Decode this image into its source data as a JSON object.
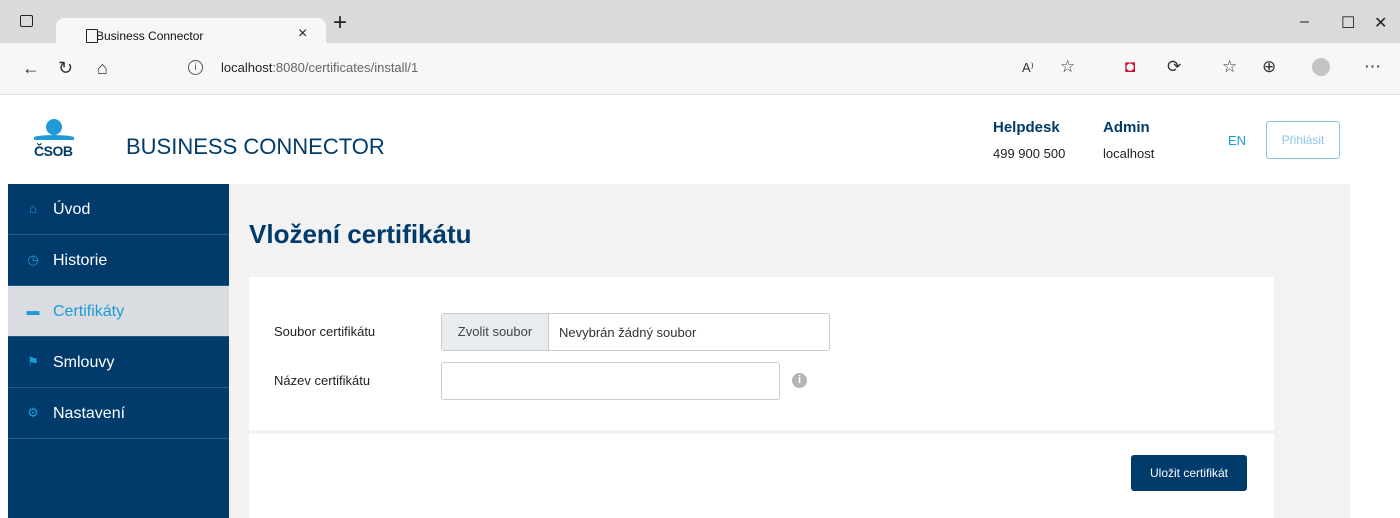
{
  "browser": {
    "tab_title": "Business Connector",
    "tab_close": "×",
    "new_tab": "+",
    "window_controls": {
      "minimize": "–",
      "maximize": "☐",
      "close": "✕"
    },
    "address_host": "localhost",
    "address_rest": ":8080/certificates/install/1",
    "nav_icons": [
      "back-icon",
      "refresh-icon",
      "home-icon"
    ],
    "toolbar_icons": [
      "read-aloud-icon",
      "add-favorite-icon",
      "mcafee-icon",
      "extensions-icon",
      "favorites-icon",
      "collections-icon",
      "profile-icon",
      "more-icon"
    ]
  },
  "header": {
    "logo_text": "ČSOB",
    "title": "BUSINESS CONNECTOR",
    "helpdesk_label": "Helpdesk",
    "helpdesk_phone": "499 900 500",
    "admin_label": "Admin",
    "admin_host": "localhost",
    "lang": "EN",
    "login_label": "Přihlásit"
  },
  "sidebar": {
    "items": [
      {
        "label": "Úvod",
        "icon": "home-icon",
        "active": false
      },
      {
        "label": "Historie",
        "icon": "clock-icon",
        "active": false
      },
      {
        "label": "Certifikáty",
        "icon": "card-icon",
        "active": true
      },
      {
        "label": "Smlouvy",
        "icon": "flag-icon",
        "active": false
      },
      {
        "label": "Nastavení",
        "icon": "gear-icon",
        "active": false
      }
    ]
  },
  "main": {
    "title": "Vložení certifikátu",
    "form": {
      "file_label": "Soubor certifikátu",
      "file_button": "Zvolit soubor",
      "file_status": "Nevybrán žádný soubor",
      "name_label": "Název certifikátu",
      "name_value": ""
    },
    "save_button": "Uložit certifikát"
  },
  "colors": {
    "brand_dark": "#003b6b",
    "brand_light": "#1d9ad7",
    "content_bg": "#f2f2f2"
  }
}
